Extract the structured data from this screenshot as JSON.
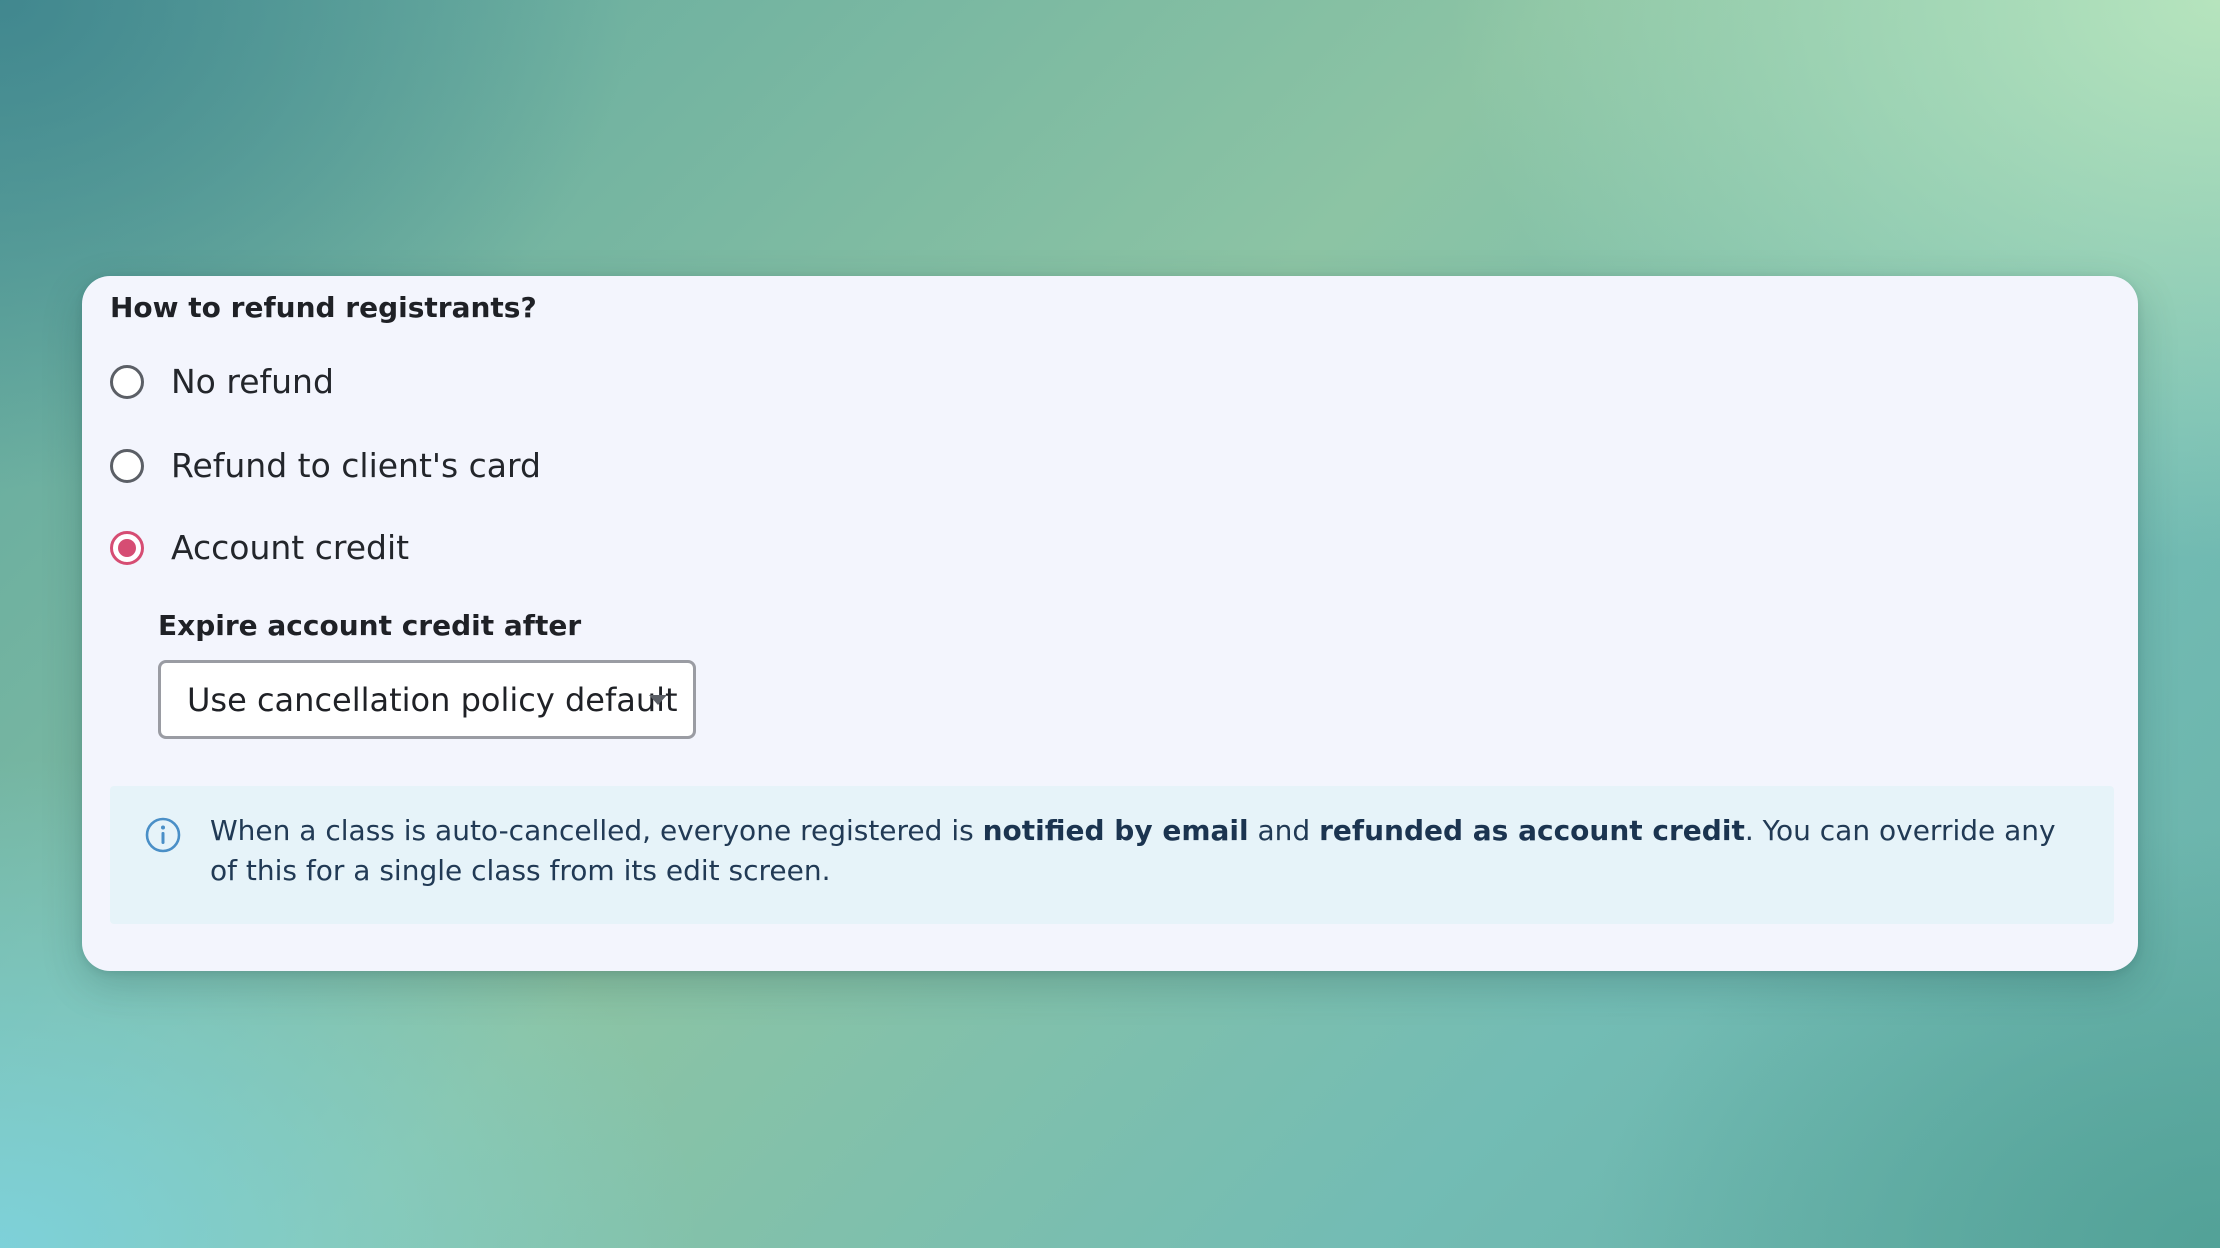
{
  "refund": {
    "question": "How to refund registrants?",
    "options": [
      {
        "label": "No refund",
        "selected": false
      },
      {
        "label": "Refund to client's card",
        "selected": false
      },
      {
        "label": "Account credit",
        "selected": true
      }
    ]
  },
  "expiry": {
    "label": "Expire account credit after",
    "selected_value": "Use cancellation policy default"
  },
  "info": {
    "icon": "info-circle-icon",
    "text_1": "When a class is auto-cancelled, everyone registered is ",
    "bold_1": "notified by email",
    "text_2": " and ",
    "bold_2": "refunded as account credit",
    "text_3": ". You can override any of this for a single class from its edit screen."
  },
  "colors": {
    "accent": "#d64d73",
    "info_background": "#e6f3f9",
    "info_icon": "#4a8fc7"
  }
}
